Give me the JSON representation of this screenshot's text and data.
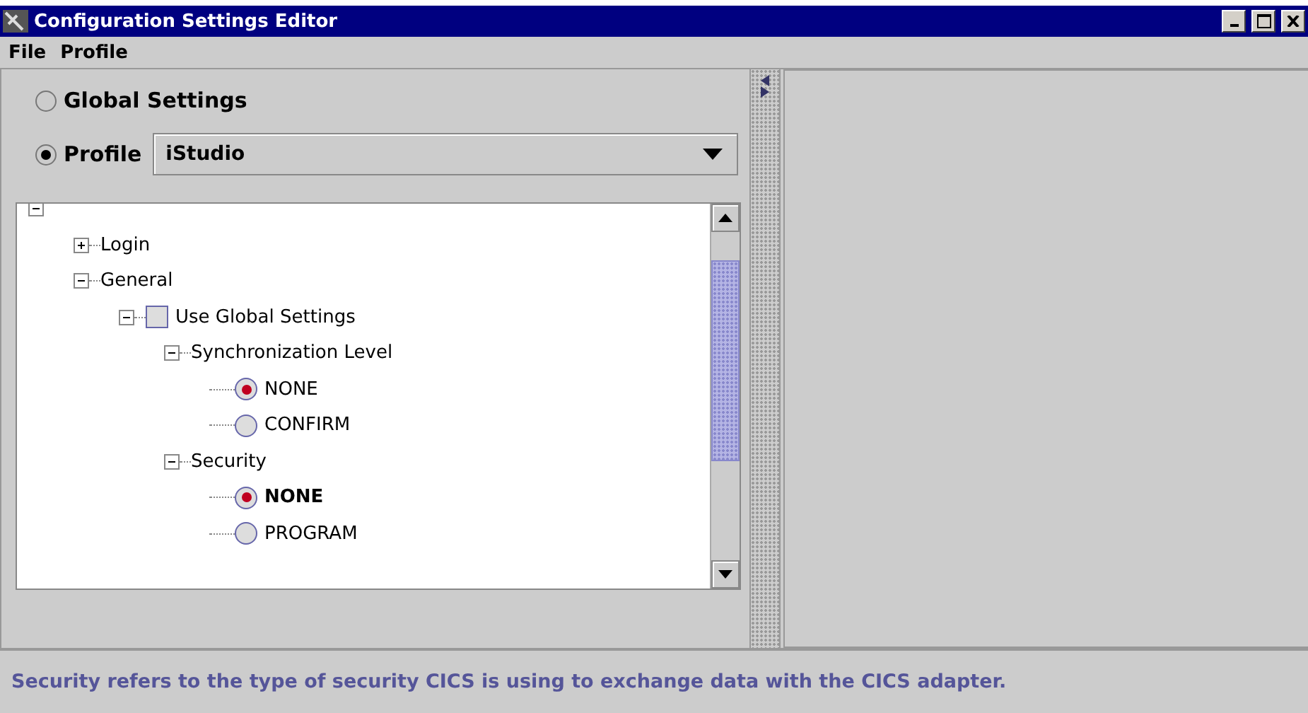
{
  "window": {
    "title": "Configuration Settings Editor"
  },
  "menu": [
    "File",
    "Profile"
  ],
  "scope_options": [
    {
      "label": "Global Settings",
      "selected": false
    },
    {
      "label": "Profile",
      "selected": true
    }
  ],
  "profile_dropdown": {
    "value": "iStudio"
  },
  "tree": [
    {
      "kind": "node",
      "expanded": true,
      "children": [
        {
          "kind": "node",
          "label": "Login",
          "expanded": false
        },
        {
          "kind": "node",
          "label": "General",
          "expanded": true,
          "children": [
            {
              "kind": "checkbox",
              "label": "Use Global Settings",
              "checked": false,
              "expanded": true,
              "children": [
                {
                  "kind": "node",
                  "label": "Synchronization Level",
                  "expanded": true,
                  "children": [
                    {
                      "kind": "radio",
                      "label": "NONE",
                      "selected": true,
                      "focused": false
                    },
                    {
                      "kind": "radio",
                      "label": "CONFIRM",
                      "selected": false,
                      "focused": false
                    }
                  ]
                },
                {
                  "kind": "node",
                  "label": "Security",
                  "expanded": true,
                  "children": [
                    {
                      "kind": "radio",
                      "label": "NONE",
                      "selected": true,
                      "focused": true
                    },
                    {
                      "kind": "radio",
                      "label": "PROGRAM",
                      "selected": false,
                      "focused": false
                    }
                  ]
                }
              ]
            }
          ]
        }
      ]
    }
  ],
  "status_bar": "Security refers to the type of security CICS is using to exchange data with the CICS adapter."
}
